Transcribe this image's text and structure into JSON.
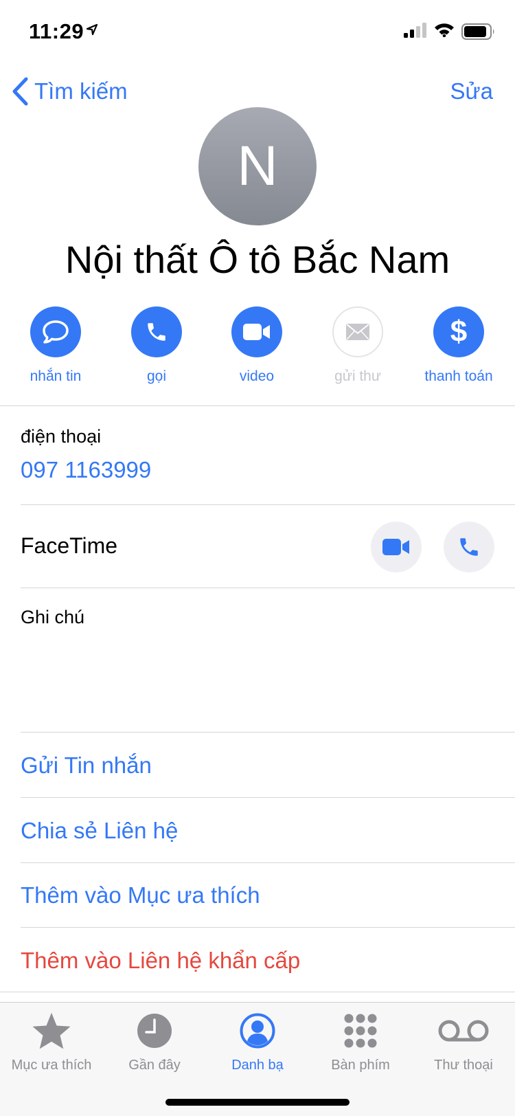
{
  "status_bar": {
    "time": "11:29"
  },
  "nav": {
    "back_label": "Tìm kiếm",
    "edit_label": "Sửa"
  },
  "contact": {
    "initial": "N",
    "name": "Nội thất Ô tô Bắc Nam"
  },
  "actions": [
    {
      "label": "nhắn tin",
      "icon": "message-icon",
      "enabled": true
    },
    {
      "label": "gọi",
      "icon": "phone-icon",
      "enabled": true
    },
    {
      "label": "video",
      "icon": "video-icon",
      "enabled": true
    },
    {
      "label": "gửi thư",
      "icon": "mail-icon",
      "enabled": false
    },
    {
      "label": "thanh toán",
      "icon": "dollar-icon",
      "enabled": true
    }
  ],
  "phone": {
    "label": "điện thoại",
    "value": "097 1163999"
  },
  "facetime": {
    "label": "FaceTime"
  },
  "notes": {
    "label": "Ghi chú"
  },
  "links": {
    "send_message": "Gửi Tin nhắn",
    "share_contact": "Chia sẻ Liên hệ",
    "add_favorite": "Thêm vào Mục ưa thích",
    "add_emergency": "Thêm vào Liên hệ khẩn cấp"
  },
  "tabbar": [
    {
      "label": "Mục ưa thích",
      "icon": "star-icon",
      "active": false
    },
    {
      "label": "Gần đây",
      "icon": "clock-icon",
      "active": false
    },
    {
      "label": "Danh bạ",
      "icon": "person-circle-icon",
      "active": true
    },
    {
      "label": "Bàn phím",
      "icon": "keypad-icon",
      "active": false
    },
    {
      "label": "Thư thoại",
      "icon": "voicemail-icon",
      "active": false
    }
  ],
  "colors": {
    "accent": "#3478f6",
    "destructive": "#e5483e",
    "inactive": "#8e8e93"
  }
}
